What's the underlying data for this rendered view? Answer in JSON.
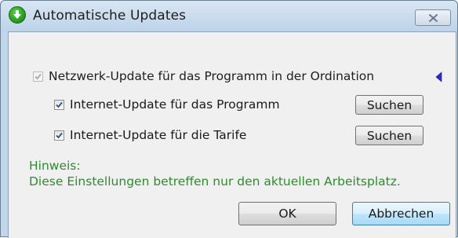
{
  "window": {
    "title": "Automatische Updates",
    "icons": {
      "app": "green-download-arrow-icon",
      "close": "close-icon"
    }
  },
  "options": {
    "network": {
      "label": "Netzwerk-Update für das Programm in der Ordination",
      "checked": true,
      "enabled": false
    },
    "internet_program": {
      "label": "Internet-Update für das Programm",
      "checked": true,
      "enabled": true,
      "button": "Suchen"
    },
    "internet_tariffs": {
      "label": "Internet-Update für die Tarife",
      "checked": true,
      "enabled": true,
      "button": "Suchen"
    }
  },
  "hint": {
    "heading": "Hinweis:",
    "text": "Diese Einstellungen betreffen nur den aktuellen Arbeitsplatz."
  },
  "buttons": {
    "ok": "OK",
    "cancel": "Abbrechen"
  },
  "colors": {
    "hint": "#2e8b2e",
    "accent": "#3c7fb1",
    "marker": "#2b2bd0"
  }
}
